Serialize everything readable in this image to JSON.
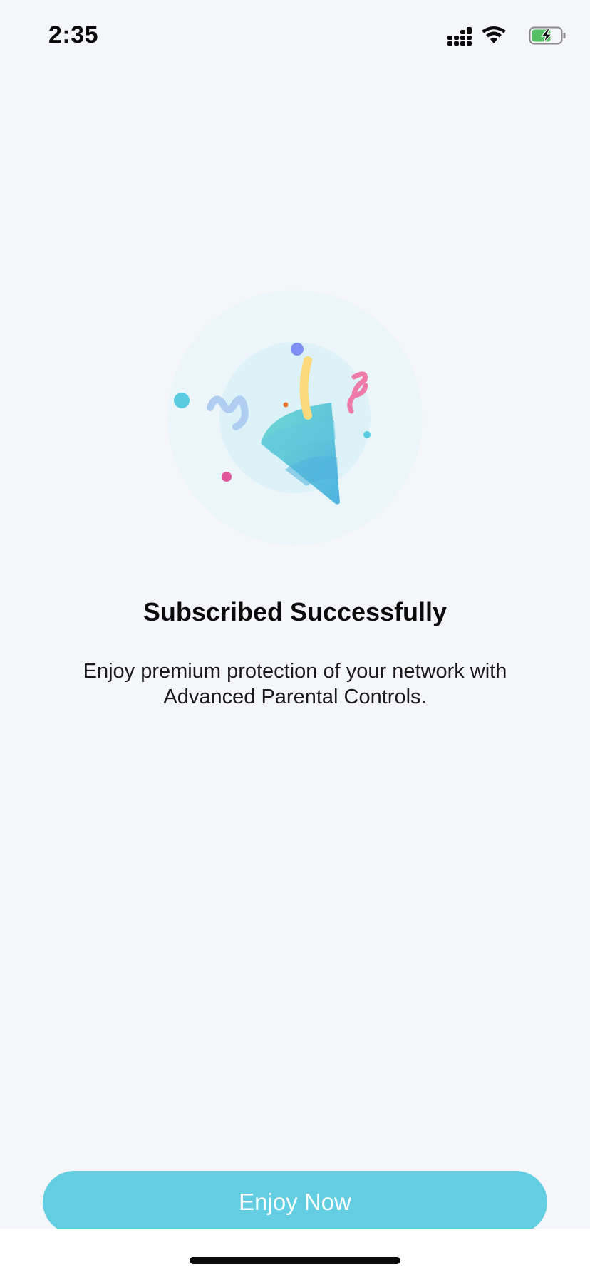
{
  "status_bar": {
    "time": "2:35",
    "icons": [
      "cellular-signal-icon",
      "wifi-icon",
      "battery-charging-icon"
    ]
  },
  "illustration": {
    "icon": "party-popper-icon",
    "colors": {
      "outer_circle": "#ecf6fa",
      "inner_circle": "#dcf2f8",
      "popper": "#5bc6dc",
      "streamer_yellow": "#fbd97c",
      "streamer_pink": "#ee7aa9",
      "streamer_blue": "#a9c9f0",
      "dot_purple": "#7f8ff5",
      "dot_cyan": "#5bcbe2",
      "dot_magenta": "#e0569a",
      "dot_orange": "#e9722a"
    }
  },
  "content": {
    "title": "Subscribed Successfully",
    "description": "Enjoy premium protection of your network with Advanced Parental Controls."
  },
  "actions": {
    "enjoy_now_label": "Enjoy Now"
  },
  "theme": {
    "accent": "#63cde2",
    "background": "#f5f6fa"
  }
}
